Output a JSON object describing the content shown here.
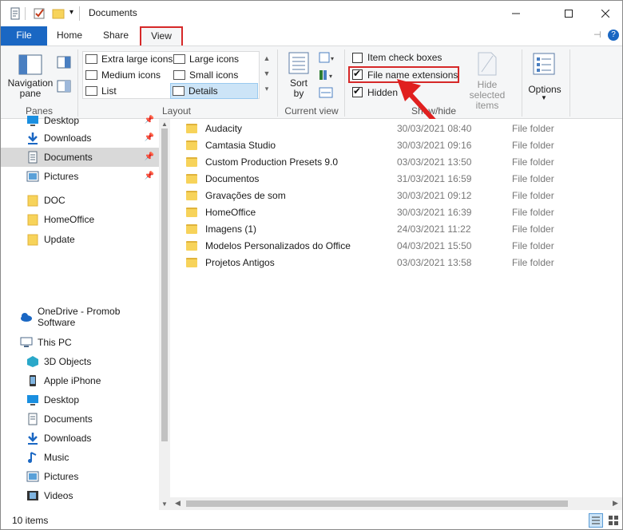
{
  "window": {
    "title": "Documents"
  },
  "tabs": {
    "file": "File",
    "home": "Home",
    "share": "Share",
    "view": "View"
  },
  "ribbon": {
    "panes": {
      "navigation_pane": "Navigation pane",
      "group_label": "Panes"
    },
    "layout": {
      "extra_large_icons": "Extra large icons",
      "large_icons": "Large icons",
      "medium_icons": "Medium icons",
      "small_icons": "Small icons",
      "list": "List",
      "details": "Details",
      "group_label": "Layout"
    },
    "current_view": {
      "sort_by": "Sort by",
      "group_label": "Current view"
    },
    "show_hide": {
      "item_check_boxes": "Item check boxes",
      "file_name_extensions": "File name extensions",
      "hidden_items": "Hidden",
      "hide_selected_items": "Hide selected items",
      "group_label": "Show/hide"
    },
    "options": "Options"
  },
  "nav": [
    {
      "label": "Desktop",
      "icon": "desktop-icon",
      "pinned": true
    },
    {
      "label": "Downloads",
      "icon": "downloads-icon",
      "pinned": true
    },
    {
      "label": "Documents",
      "icon": "documents-icon",
      "pinned": true,
      "selected": true
    },
    {
      "label": "Pictures",
      "icon": "pictures-icon",
      "pinned": true
    },
    {
      "label": "DOC",
      "icon": "folder-icon"
    },
    {
      "label": "HomeOffice",
      "icon": "folder-icon"
    },
    {
      "label": "Update",
      "icon": "folder-icon"
    },
    {
      "label": "OneDrive - Promob Software",
      "icon": "onedrive-icon"
    },
    {
      "label": "This PC",
      "icon": "pc-icon"
    },
    {
      "label": "3D Objects",
      "icon": "3d-objects-icon"
    },
    {
      "label": "Apple iPhone",
      "icon": "phone-icon"
    },
    {
      "label": "Desktop",
      "icon": "desktop-icon"
    },
    {
      "label": "Documents",
      "icon": "documents-icon"
    },
    {
      "label": "Downloads",
      "icon": "downloads-icon"
    },
    {
      "label": "Music",
      "icon": "music-icon"
    },
    {
      "label": "Pictures",
      "icon": "pictures-icon"
    },
    {
      "label": "Videos",
      "icon": "videos-icon"
    }
  ],
  "files": [
    {
      "name": "Audacity",
      "date": "30/03/2021 08:40",
      "type": "File folder"
    },
    {
      "name": "Camtasia Studio",
      "date": "30/03/2021 09:16",
      "type": "File folder"
    },
    {
      "name": "Custom Production Presets 9.0",
      "date": "03/03/2021 13:50",
      "type": "File folder"
    },
    {
      "name": "Documentos",
      "date": "31/03/2021 16:59",
      "type": "File folder"
    },
    {
      "name": "Gravações de som",
      "date": "30/03/2021 09:12",
      "type": "File folder"
    },
    {
      "name": "HomeOffice",
      "date": "30/03/2021 16:39",
      "type": "File folder"
    },
    {
      "name": "Imagens (1)",
      "date": "24/03/2021 11:22",
      "type": "File folder"
    },
    {
      "name": "Modelos Personalizados do Office",
      "date": "04/03/2021 15:50",
      "type": "File folder"
    },
    {
      "name": "Projetos Antigos",
      "date": "03/03/2021 13:58",
      "type": "File folder"
    }
  ],
  "status": {
    "item_count": "10 items"
  },
  "colors": {
    "accent": "#1a67c3",
    "highlight": "#d62828",
    "folder": "#f7d35a"
  }
}
